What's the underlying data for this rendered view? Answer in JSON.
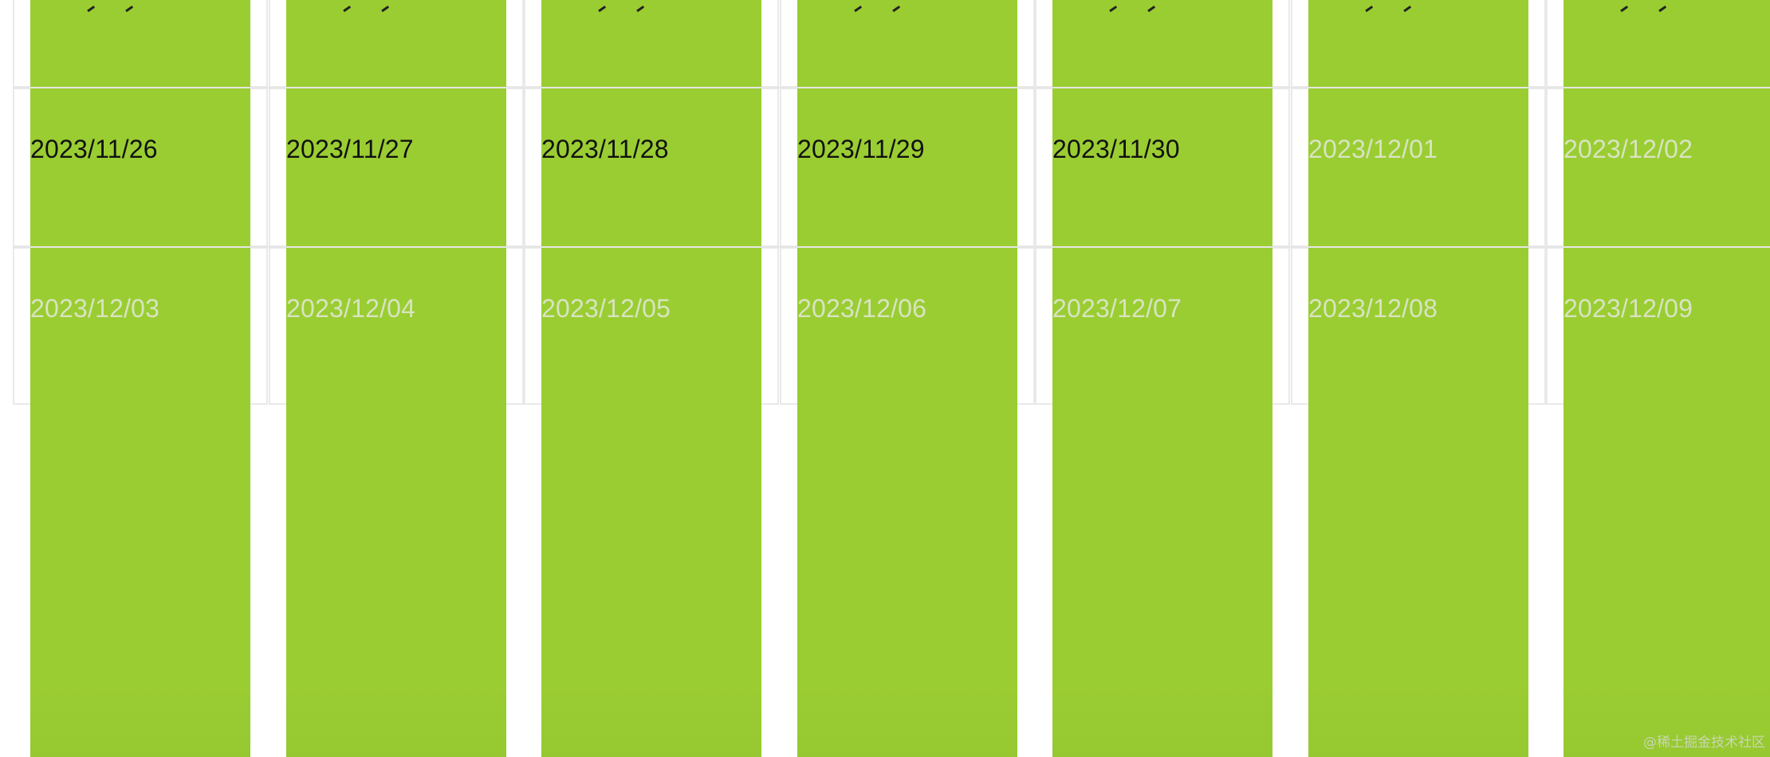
{
  "calendar": {
    "colors": {
      "column_green": "#9acd32",
      "current_month_text": "#111111",
      "other_month_text": "#d9e3c2",
      "grid_line": "#e9e9e9"
    },
    "rows": [
      {
        "dates": [
          {
            "label": "2023/11/26",
            "current": true
          },
          {
            "label": "2023/11/27",
            "current": true
          },
          {
            "label": "2023/11/28",
            "current": true
          },
          {
            "label": "2023/11/29",
            "current": true
          },
          {
            "label": "2023/11/30",
            "current": true
          },
          {
            "label": "2023/12/01",
            "current": false
          },
          {
            "label": "2023/12/02",
            "current": false
          }
        ]
      },
      {
        "dates": [
          {
            "label": "2023/12/03",
            "current": false
          },
          {
            "label": "2023/12/04",
            "current": false
          },
          {
            "label": "2023/12/05",
            "current": false
          },
          {
            "label": "2023/12/06",
            "current": false
          },
          {
            "label": "2023/12/07",
            "current": false
          },
          {
            "label": "2023/12/08",
            "current": false
          },
          {
            "label": "2023/12/09",
            "current": false
          }
        ]
      }
    ]
  },
  "watermark": "@稀土掘金技术社区"
}
